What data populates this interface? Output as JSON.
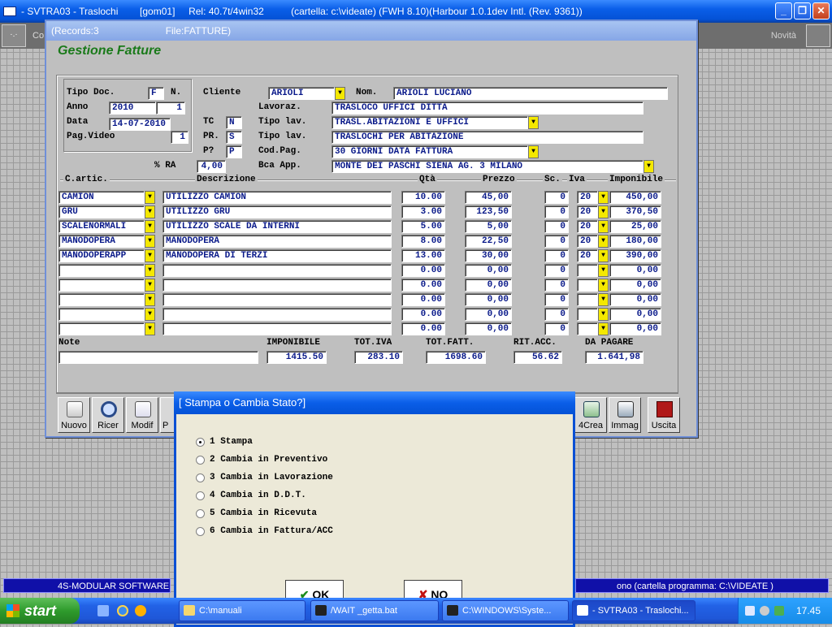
{
  "window": {
    "title": "- SVTRA03 - Traslochi        [gom01]     Rel: 40.7t/4win32          (cartella: c:\\videate) (FWH 8.10)(Harbour 1.0.1dev Intl. (Rev. 9361))",
    "minimize": "_",
    "maximize": "❐",
    "close": "✕"
  },
  "appbar": {
    "grip": "·.·",
    "co": "Co",
    "novita": "Novità"
  },
  "child": {
    "records": "(Records:3",
    "file": "File:FATTURE)",
    "heading": "Gestione Fatture"
  },
  "header": {
    "tipo_doc_label": "Tipo Doc.",
    "tipo_doc": "F",
    "n_label": "N.",
    "anno_label": "Anno",
    "anno": "2010",
    "numero": "1",
    "data_label": "Data",
    "data": "14-07-2010",
    "pag_video_label": "Pag.Video",
    "pag_video": "1",
    "cliente_label": "Cliente",
    "cliente": "ARIOLI",
    "nom_label": "Nom.",
    "nominativo": "ARIOLI LUCIANO",
    "lavoraz_label": "Lavoraz.",
    "lavorazione": "TRASLOCO UFFICI DITTA",
    "tc_label": "TC",
    "tc": "N",
    "tipo_lav_label": "Tipo lav.",
    "tipo_lav_1": "TRASL.ABITAZIONI E UFFICI",
    "pr_label": "PR.",
    "pr": "S",
    "tipo_lav_label_2": "Tipo lav.",
    "tipo_lav_2": "TRASLOCHI PER ABITAZIONE",
    "p_label": "P?",
    "p": "P",
    "cod_pag_label": "Cod.Pag.",
    "cod_pag": "30 GIORNI DATA FATTURA",
    "ra_label": "% RA",
    "ra": "4,00",
    "bca_label": "Bca App.",
    "banca": "MONTE DEI PASCHI SIENA  AG. 3  MILANO"
  },
  "columns": {
    "art": "C.artic.",
    "desc": "Descrizione",
    "qta": "Qtà",
    "prezzo": "Prezzo",
    "sc": "Sc.",
    "iva": "Iva",
    "imponibile": "Imponibile"
  },
  "rows": [
    {
      "art": "CAMION",
      "desc": "UTILIZZO CAMION",
      "qta": "10.00",
      "prezzo": "45,00",
      "sc": "0",
      "iva": "20",
      "imp": "450,00"
    },
    {
      "art": "GRU",
      "desc": "UTILIZZO GRU",
      "qta": "3.00",
      "prezzo": "123,50",
      "sc": "0",
      "iva": "20",
      "imp": "370,50"
    },
    {
      "art": "SCALENORMALI",
      "desc": "UTILIZZO SCALE DA INTERNI",
      "qta": "5.00",
      "prezzo": "5,00",
      "sc": "0",
      "iva": "20",
      "imp": "25,00"
    },
    {
      "art": "MANODOPERA",
      "desc": "MANODOPERA",
      "qta": "8.00",
      "prezzo": "22,50",
      "sc": "0",
      "iva": "20",
      "imp": "180,00"
    },
    {
      "art": "MANODOPERAPP",
      "desc": "MANODOPERA DI TERZI",
      "qta": "13.00",
      "prezzo": "30,00",
      "sc": "0",
      "iva": "20",
      "imp": "390,00"
    },
    {
      "art": "",
      "desc": "",
      "qta": "0.00",
      "prezzo": "0,00",
      "sc": "0",
      "iva": "",
      "imp": "0,00"
    },
    {
      "art": "",
      "desc": "",
      "qta": "0.00",
      "prezzo": "0,00",
      "sc": "0",
      "iva": "",
      "imp": "0,00"
    },
    {
      "art": "",
      "desc": "",
      "qta": "0.00",
      "prezzo": "0,00",
      "sc": "0",
      "iva": "",
      "imp": "0,00"
    },
    {
      "art": "",
      "desc": "",
      "qta": "0.00",
      "prezzo": "0,00",
      "sc": "0",
      "iva": "",
      "imp": "0,00"
    },
    {
      "art": "",
      "desc": "",
      "qta": "0.00",
      "prezzo": "0,00",
      "sc": "0",
      "iva": "",
      "imp": "0,00"
    }
  ],
  "totals": {
    "note_label": "Note",
    "note": "",
    "imponibile_label": "IMPONIBILE",
    "imponibile": "1415.50",
    "tot_iva_label": "TOT.IVA",
    "tot_iva": "283.10",
    "tot_fatt_label": "TOT.FATT.",
    "tot_fatt": "1698.60",
    "rit_acc_label": "RIT.ACC.",
    "rit_acc": "56.62",
    "da_pagare_label": "DA PAGARE",
    "da_pagare": "1.641,98"
  },
  "toolbar": {
    "nuovo": "Nuovo",
    "ricer": "Ricer",
    "modif": "Modif",
    "partial": "P",
    "crea4": "4Crea",
    "immag": "Immag",
    "uscita": "Uscita"
  },
  "dialog": {
    "title": "[ Stampa o Cambia Stato?]",
    "options": [
      "1 Stampa",
      "2 Cambia in Preventivo",
      "3 Cambia in Lavorazione",
      "4 Cambia in D.D.T.",
      "5 Cambia in Ricevuta",
      "6 Cambia in Fattura/ACC"
    ],
    "selected": 0,
    "ok": "OK",
    "no": "NO"
  },
  "status": {
    "left": "4S-MODULAR SOFTWARE",
    "right": "ono  (cartella programma: C:\\VIDEATE )"
  },
  "taskbar": {
    "start": "start",
    "tasks": [
      "C:\\manuali",
      "/WAIT _getta.bat",
      "C:\\WINDOWS\\Syste...",
      "- SVTRA03 - Traslochi..."
    ],
    "clock": "17.45"
  },
  "colors": {
    "yellow": "#f4e800",
    "field_text": "#0a1a8a",
    "heading_green": "#1a7a1a",
    "xp_blue": "#0a5ee8"
  }
}
